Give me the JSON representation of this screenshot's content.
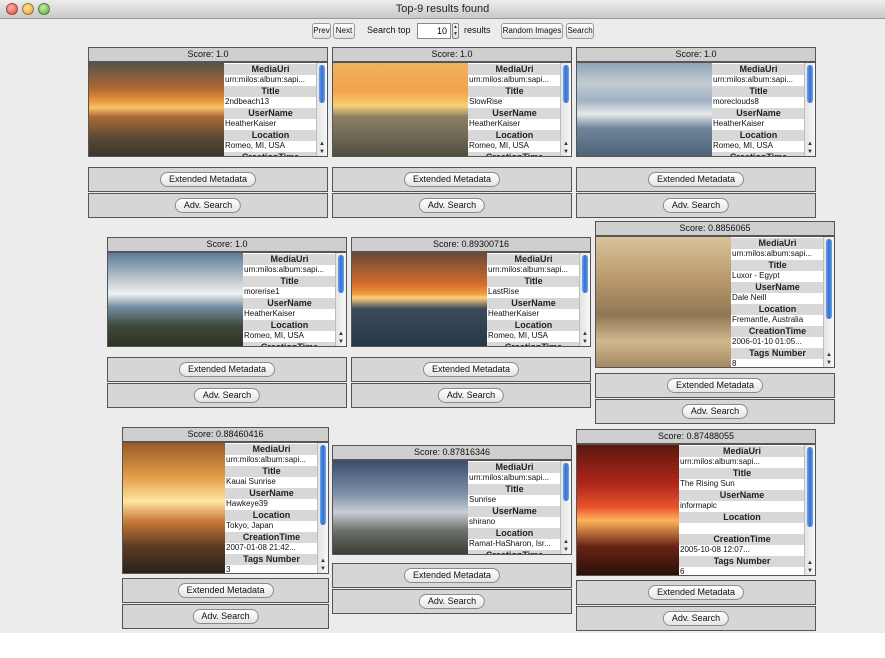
{
  "window": {
    "title": "Top-9 results found"
  },
  "toolbar": {
    "prev_label": "Prev",
    "next_label": "Next",
    "search_top_label": "Search top",
    "top_count": "10",
    "results_label": "results",
    "random_images_label": "Random Images",
    "search_label": "Search"
  },
  "labels": {
    "media_uri": "MediaUri",
    "title": "Title",
    "user_name": "UserName",
    "location": "Location",
    "creation_time": "CreationTime",
    "tags_number": "Tags Number",
    "extended_metadata": "Extended Metadata",
    "adv_search": "Adv. Search"
  },
  "results": [
    {
      "score": "Score: 1.0",
      "media_uri": "urn:milos:album:sapi...",
      "title": "2ndbeach13",
      "user_name": "HeatherKaiser",
      "location": "Romeo, MI, USA"
    },
    {
      "score": "Score: 1.0",
      "media_uri": "urn:milos:album:sapi...",
      "title": "SlowRise",
      "user_name": "HeatherKaiser",
      "location": "Romeo, MI, USA"
    },
    {
      "score": "Score: 1.0",
      "media_uri": "urn:milos:album:sapi...",
      "title": "moreclouds8",
      "user_name": "HeatherKaiser",
      "location": "Romeo, MI, USA"
    },
    {
      "score": "Score: 1.0",
      "media_uri": "urn:milos:album:sapi...",
      "title": "morerise1",
      "user_name": "HeatherKaiser",
      "location": "Romeo, MI, USA"
    },
    {
      "score": "Score: 0.89300716",
      "media_uri": "urn:milos:album:sapi...",
      "title": "LastRise",
      "user_name": "HeatherKaiser",
      "location": "Romeo, MI, USA"
    },
    {
      "score": "Score: 0.8856065",
      "media_uri": "urn:milos:album:sapi...",
      "title": "Luxor - Egypt",
      "user_name": "Dale Neill",
      "location": "Fremantle, Australia",
      "creation_time": "2006-01-10 01:05...",
      "tags_number": "8"
    },
    {
      "score": "Score: 0.88460416",
      "media_uri": "urn:milos:album:sapi...",
      "title": "Kauai Sunrise",
      "user_name": "Hawkeye39",
      "location": "Tokyo, Japan",
      "creation_time": "2007-01-08 21:42...",
      "tags_number": "3"
    },
    {
      "score": "Score: 0.87816346",
      "media_uri": "urn:milos:album:sapi...",
      "title": "Sunrise",
      "user_name": "shirano",
      "location": "Ramat-HaSharon, Isr..."
    },
    {
      "score": "Score: 0.87488055",
      "media_uri": "urn:milos:album:sapi...",
      "title": "The Rising Sun",
      "user_name": "informaplc",
      "location": "",
      "creation_time": "2005-10-08 12:07...",
      "tags_number": "6"
    }
  ]
}
